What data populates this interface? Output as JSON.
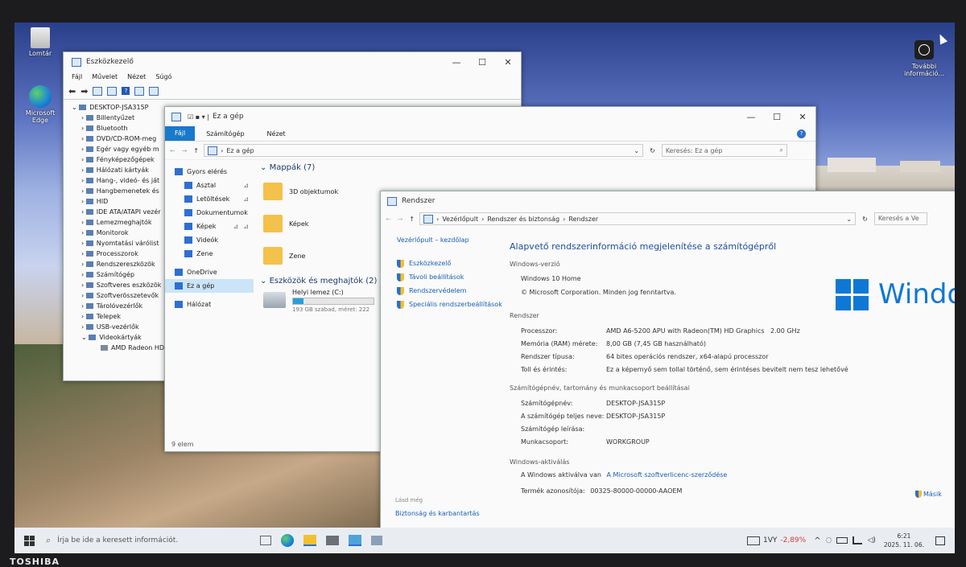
{
  "desktop": {
    "icons": [
      {
        "label": "Lomtár"
      },
      {
        "label": "Microsoft Edge"
      }
    ],
    "more_info": "További információ..."
  },
  "device_manager": {
    "title": "Eszközkezelő",
    "menu": [
      "Fájl",
      "Művelet",
      "Nézet",
      "Súgó"
    ],
    "root": "DESKTOP-JSA315P",
    "items": [
      "Billentyűzet",
      "Bluetooth",
      "DVD/CD-ROM-meg",
      "Egér vagy egyéb m",
      "Fényképezőgépek",
      "Hálózati kártyák",
      "Hang-, videó- és ját",
      "Hangbemenetek és",
      "HID",
      "IDE ATA/ATAPI vezér",
      "Lemezmeghajtók",
      "Monitorok",
      "Nyomtatási várólist",
      "Processzorok",
      "Rendszereszközök",
      "Számítógép",
      "Szoftveres eszközök",
      "Szoftverösszetevők",
      "Tárolóvezérlők",
      "Telepek",
      "USB-vezérlők",
      "Videokártyák"
    ],
    "subitem": "AMD Radeon HD"
  },
  "explorer": {
    "title": "Ez a gép",
    "tabs": [
      "Fájl",
      "Számítógép",
      "Nézet"
    ],
    "address": "Ez a gép",
    "search_placeholder": "Keresés: Ez a gép",
    "nav": [
      "Gyors elérés",
      "Asztal",
      "Letöltések",
      "Dokumentumok",
      "Képek",
      "Videók",
      "Zene",
      "OneDrive",
      "Ez a gép",
      "Hálózat"
    ],
    "folders_header": "Mappák (7)",
    "folders": [
      "3D objektumok",
      "Képek",
      "Zene"
    ],
    "devices_header": "Eszközök és meghajtók (2)",
    "drive_name": "Helyi lemez (C:)",
    "drive_info": "193 GB szabad, méret: 222",
    "drive_fill": 0.13,
    "status": "9 elem"
  },
  "system": {
    "title": "Rendszer",
    "breadcrumb": [
      "Vezérlőpult",
      "Rendszer és biztonság",
      "Rendszer"
    ],
    "search_placeholder": "Keresés a Ve",
    "side_home": "Vezérlőpult – kezdőlap",
    "side_links": [
      "Eszközkezelő",
      "Távoli beállítások",
      "Rendszervédelem",
      "Speciális rendszerbeállítások"
    ],
    "see_also": "Lásd még",
    "security": "Biztonság és karbantartás",
    "heading": "Alapvető rendszerinformáció megjelenítése a számítógépről",
    "winver_title": "Windows-verzió",
    "winver": "Windows 10 Home",
    "copyright": "© Microsoft Corporation. Minden jog fenntartva.",
    "brand": "Windo",
    "sys_title": "Rendszer",
    "processor_k": "Processzor:",
    "processor_v": "AMD A6-5200 APU with Radeon(TM) HD Graphics",
    "processor_ghz": "2.00 GHz",
    "ram_k": "Memória (RAM) mérete:",
    "ram_v": "8,00 GB (7,45 GB használható)",
    "systype_k": "Rendszer típusa:",
    "systype_v": "64 bites operációs rendszer, x64-alapú processzor",
    "pen_k": "Toll és érintés:",
    "pen_v": "Ez a képernyő sem tollal történő, sem érintéses bevitelt nem tesz lehetővé",
    "comp_title": "Számítógépnév, tartomány és munkacsoport beállításai",
    "compname_k": "Számítógépnév:",
    "compname_v": "DESKTOP-JSA315P",
    "fullname_k": "A számítógép teljes neve:",
    "fullname_v": "DESKTOP-JSA315P",
    "desc_k": "Számítógép leírása:",
    "workgroup_k": "Munkacsoport:",
    "workgroup_v": "WORKGROUP",
    "act_title": "Windows-aktiválás",
    "act_text": "A Windows aktiválva van",
    "act_link": "A Microsoft szoftverlicenc-szerződése",
    "product_k": "Termék azonosítója:",
    "product_v": "00325-80000-00000-AAOEM",
    "change": "Másik"
  },
  "taskbar": {
    "search_placeholder": "Írja be ide a keresett információt.",
    "ticker": "1VY",
    "change": "-2,89%",
    "time": "6:21",
    "date": "2025. 11. 06."
  },
  "bezel": {
    "brand": "TOSHIBA"
  },
  "colors": {
    "accent": "#0078d7",
    "link": "#1a5fb4",
    "negative": "#d83b3b",
    "ribbon_file": "#1979ca"
  }
}
